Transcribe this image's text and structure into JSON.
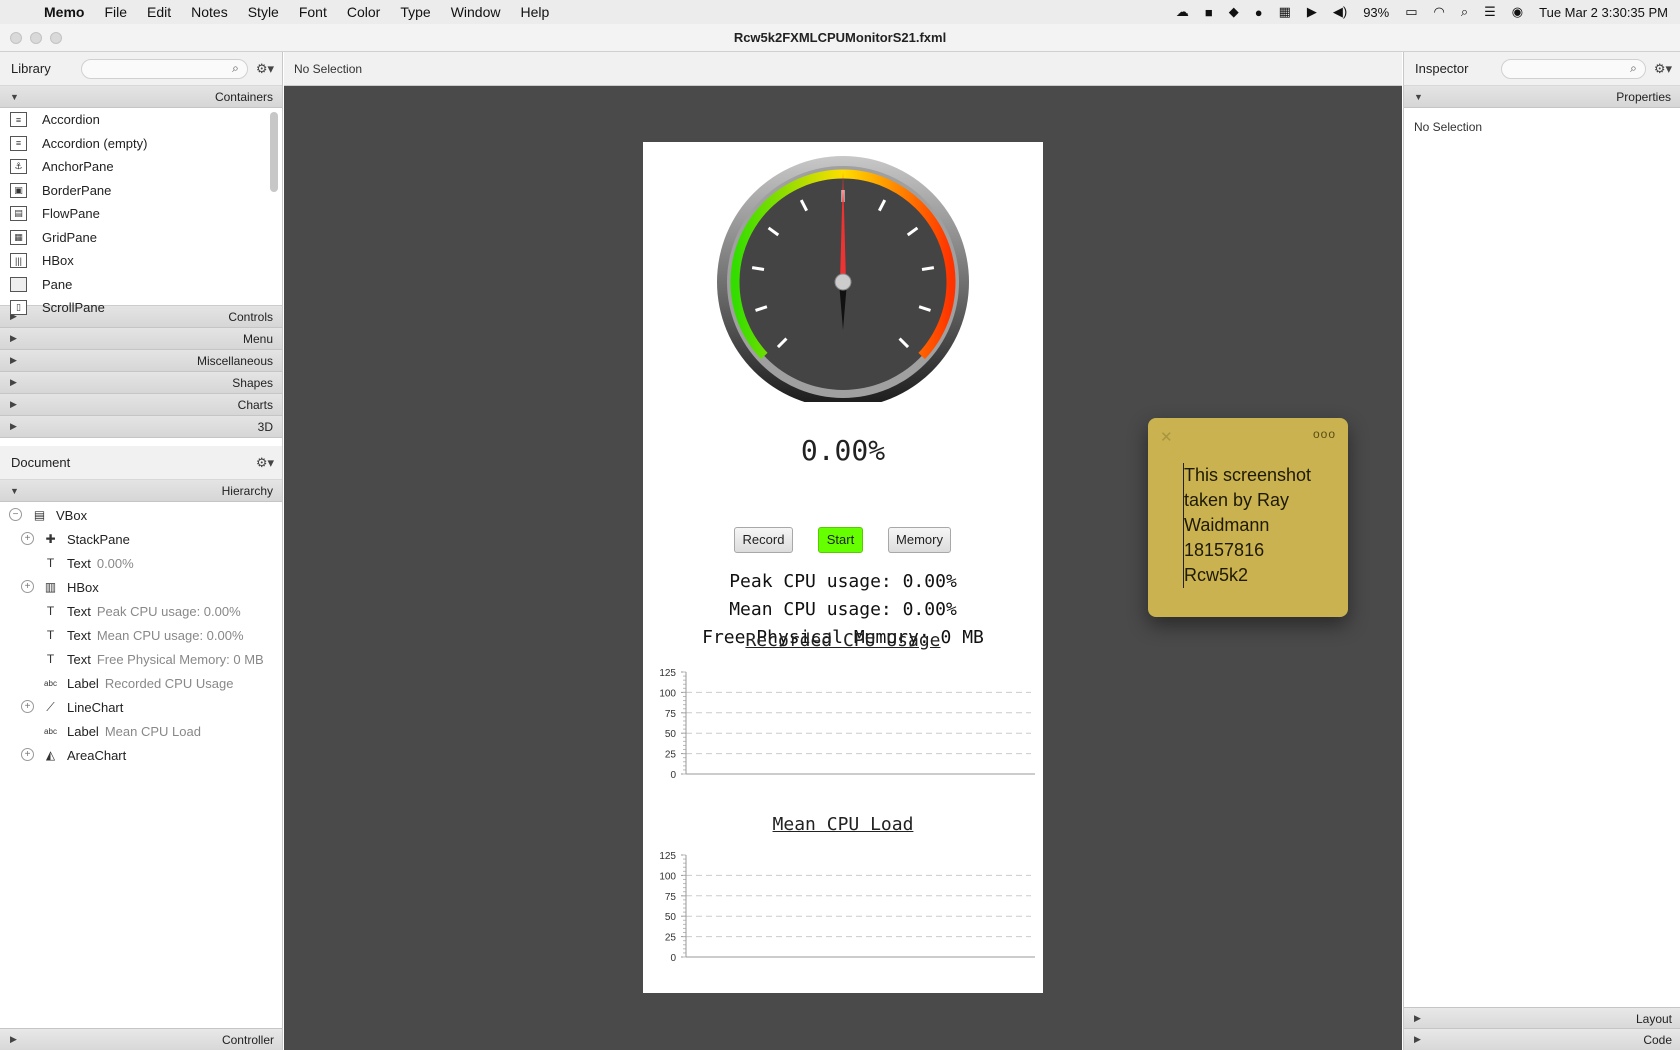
{
  "menubar": {
    "app": "Memo",
    "items": [
      "File",
      "Edit",
      "Notes",
      "Style",
      "Font",
      "Color",
      "Type",
      "Window",
      "Help"
    ],
    "battery": "93%",
    "clock": "Tue Mar 2  3:30:35 PM"
  },
  "window": {
    "title": "Rcw5k2FXMLCPUMonitorS21.fxml"
  },
  "library": {
    "title": "Library",
    "search_placeholder": "",
    "sections": {
      "containers": "Containers",
      "controls": "Controls",
      "menu": "Menu",
      "misc": "Miscellaneous",
      "shapes": "Shapes",
      "charts": "Charts",
      "threed": "3D"
    },
    "items": [
      "Accordion",
      "Accordion  (empty)",
      "AnchorPane",
      "BorderPane",
      "FlowPane",
      "GridPane",
      "HBox",
      "Pane",
      "ScrollPane"
    ]
  },
  "document": {
    "title": "Document",
    "hierarchy_label": "Hierarchy",
    "tree": [
      {
        "type": "VBox",
        "text": ""
      },
      {
        "type": "StackPane",
        "text": ""
      },
      {
        "type": "Text",
        "text": "0.00%"
      },
      {
        "type": "HBox",
        "text": ""
      },
      {
        "type": "Text",
        "text": "Peak CPU usage: 0.00%"
      },
      {
        "type": "Text",
        "text": "Mean CPU usage: 0.00%"
      },
      {
        "type": "Text",
        "text": "Free Physical Memory: 0 MB"
      },
      {
        "type": "Label",
        "text": "Recorded CPU Usage"
      },
      {
        "type": "LineChart",
        "text": ""
      },
      {
        "type": "Label",
        "text": "Mean CPU Load"
      },
      {
        "type": "AreaChart",
        "text": ""
      }
    ],
    "controller": "Controller"
  },
  "canvas": {
    "selection": "No Selection",
    "gauge_readout": "0.00%",
    "gauge_value": 0,
    "buttons": {
      "record": "Record",
      "start": "Start",
      "memory": "Memory"
    },
    "peak": "Peak CPU usage: 0.00%",
    "mean": "Mean CPU usage: 0.00%",
    "memory": "Free Physical Memory: 0 MB",
    "start_color": "#66ff00"
  },
  "chart_data": [
    {
      "type": "line",
      "title": "Recorded CPU Usage",
      "ylim": [
        0,
        125
      ],
      "yticks": [
        "125",
        "100",
        "75",
        "50",
        "25",
        "0"
      ],
      "grid": true,
      "series": []
    },
    {
      "type": "area",
      "title": "Mean CPU Load",
      "ylim": [
        0,
        125
      ],
      "yticks": [
        "125",
        "100",
        "75",
        "50",
        "25",
        "0"
      ],
      "grid": true,
      "series": []
    }
  ],
  "note": {
    "text": "This screenshot\ntaken by Ray\nWaidmann\n18157816\nRcw5k2",
    "color": "#c9b24f"
  },
  "inspector": {
    "title": "Inspector",
    "properties_label": "Properties",
    "selection": "No Selection",
    "layout_label": "Layout",
    "code_label": "Code"
  }
}
